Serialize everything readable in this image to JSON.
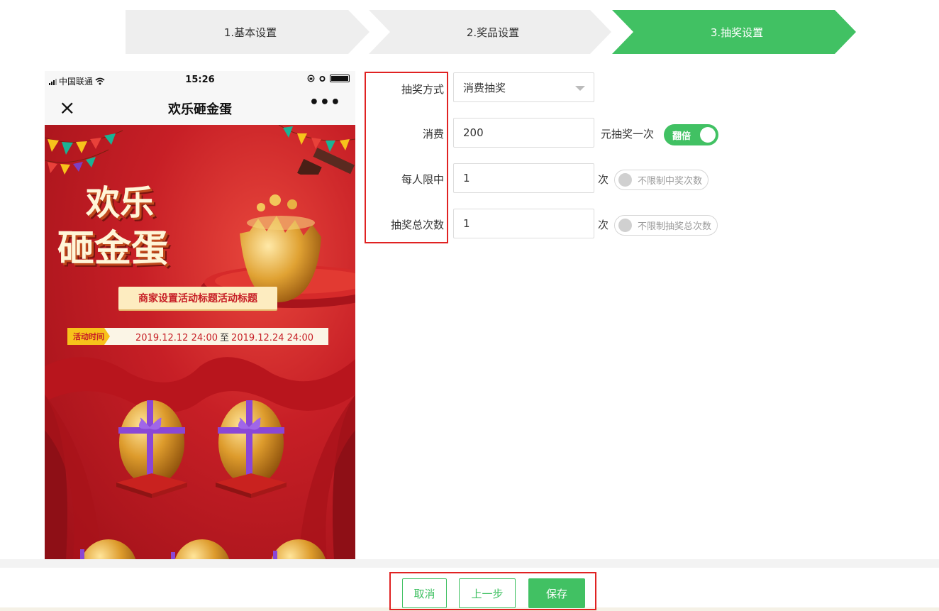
{
  "steps": [
    {
      "label": "1.基本设置",
      "active": false
    },
    {
      "label": "2.奖品设置",
      "active": false
    },
    {
      "label": "3.抽奖设置",
      "active": true
    }
  ],
  "colors": {
    "accent": "#41c163",
    "highlight_border": "#e02222",
    "poster_red": "#c71f26"
  },
  "phone": {
    "carrier": "中国联通",
    "time": "15:26",
    "title": "欢乐砸金蛋",
    "close_icon": "×",
    "more_icon": "•••",
    "poster": {
      "logo_line1": "欢乐",
      "logo_line2": "砸金蛋",
      "banner": "商家设置活动标题活动标题",
      "time_tag": "活动时间",
      "start": "2019.12.12 24:00",
      "separator": "至",
      "end": "2019.12.24 24:00"
    }
  },
  "form": {
    "method": {
      "label": "抽奖方式",
      "value": "消费抽奖"
    },
    "spend": {
      "label": "消费",
      "value": "200",
      "suffix": "元抽奖一次",
      "toggle_label": "翻倍",
      "toggle_on": true
    },
    "per_person": {
      "label": "每人限中",
      "value": "1",
      "suffix": "次",
      "toggle_label": "不限制中奖次数",
      "toggle_on": false
    },
    "total": {
      "label": "抽奖总次数",
      "value": "1",
      "suffix": "次",
      "toggle_label": "不限制抽奖总次数",
      "toggle_on": false
    }
  },
  "footer": {
    "cancel": "取消",
    "prev": "上一步",
    "save": "保存"
  }
}
